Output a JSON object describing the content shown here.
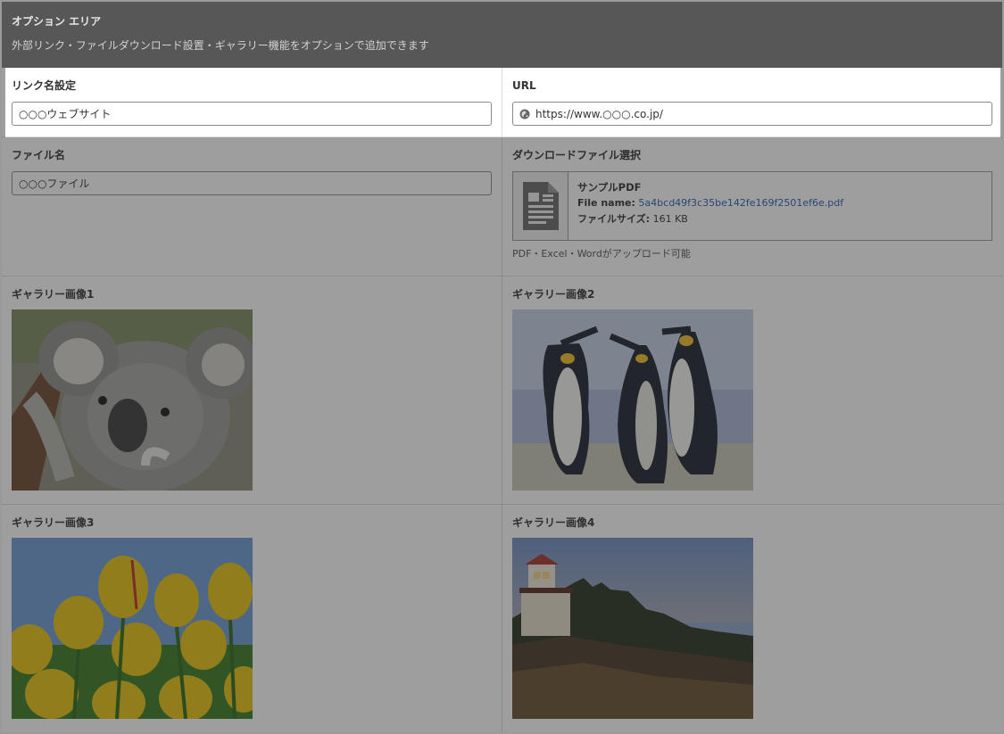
{
  "header": {
    "title": "オプション エリア",
    "description": "外部リンク・ファイルダウンロード設置・ギャラリー機能をオプションで追加できます"
  },
  "link_name": {
    "label": "リンク名設定",
    "value": "○○○ウェブサイト"
  },
  "url": {
    "label": "URL",
    "value": "https://www.○○○.co.jp/"
  },
  "file_name": {
    "label": "ファイル名",
    "value": "○○○ファイル"
  },
  "download": {
    "label": "ダウンロードファイル選択",
    "title": "サンプルPDF",
    "file_name_label": "File name:",
    "file_name_value": "5a4bcd49f3c35be142fe169f2501ef6e.pdf",
    "file_size_label": "ファイルサイズ:",
    "file_size_value": "161 KB",
    "note": "PDF・Excel・Wordがアップロード可能"
  },
  "gallery": [
    {
      "label": "ギャラリー画像1",
      "subject": "koala"
    },
    {
      "label": "ギャラリー画像2",
      "subject": "penguins"
    },
    {
      "label": "ギャラリー画像3",
      "subject": "tulips"
    },
    {
      "label": "ギャラリー画像4",
      "subject": "lighthouse"
    }
  ],
  "colors": {
    "overlay": "#282828",
    "link": "#2a5db0"
  }
}
